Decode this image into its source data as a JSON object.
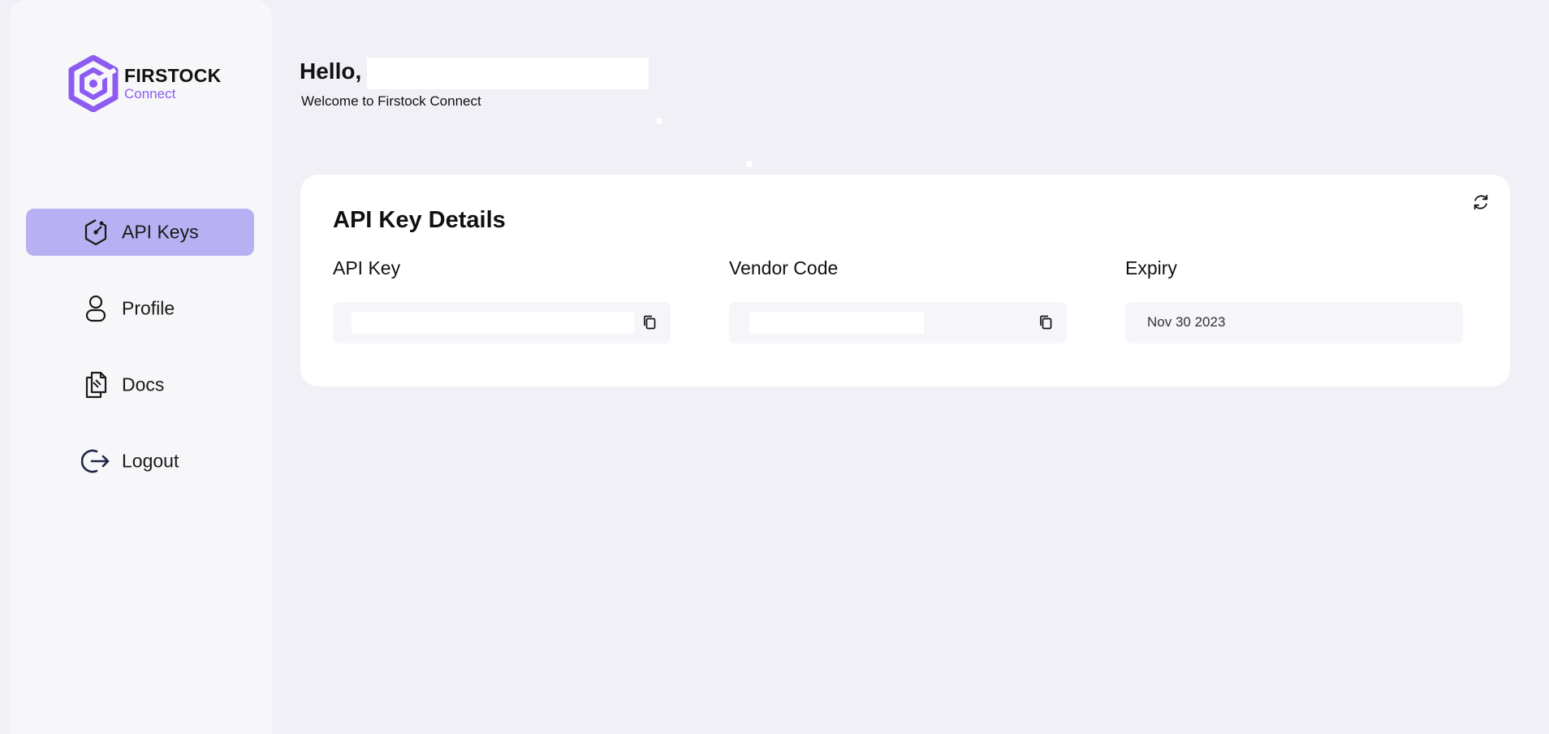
{
  "brand": {
    "name": "FIRSTOCK",
    "sub": "Connect",
    "accent": "#8c5cf0"
  },
  "sidebar": {
    "items": [
      {
        "label": "API Keys",
        "icon": "api-key-icon",
        "active": true
      },
      {
        "label": "Profile",
        "icon": "user-icon",
        "active": false
      },
      {
        "label": "Docs",
        "icon": "documents-icon",
        "active": false
      },
      {
        "label": "Logout",
        "icon": "logout-icon",
        "active": false
      }
    ],
    "active_color": "#b7b0f2"
  },
  "header": {
    "greeting": "Hello,",
    "welcome": "Welcome to Firstock Connect"
  },
  "card": {
    "title": "API Key Details",
    "refresh_icon": "refresh-icon",
    "fields": [
      {
        "label": "API Key",
        "value": "",
        "copy_icon": "copy-icon"
      },
      {
        "label": "Vendor Code",
        "value": "",
        "copy_icon": "copy-icon"
      },
      {
        "label": "Expiry",
        "value": "Nov 30 2023"
      }
    ]
  }
}
